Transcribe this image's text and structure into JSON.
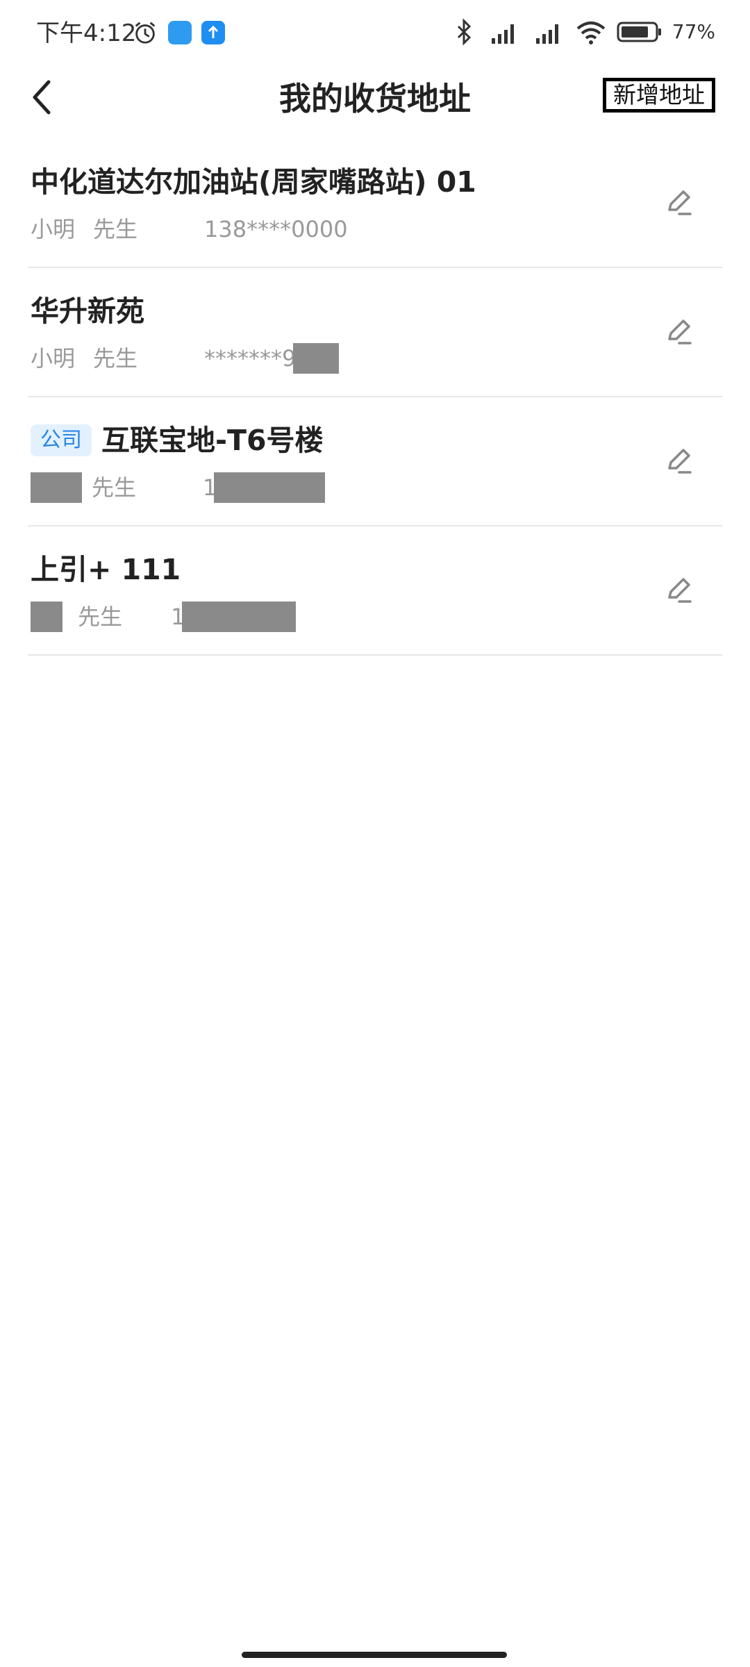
{
  "status_bar": {
    "time": "下午4:12",
    "battery_pct": "77%",
    "icons": [
      "alarm-icon",
      "weather-icon",
      "upload-icon",
      "bluetooth-icon",
      "signal-hd-icon",
      "signal-hd-icon",
      "wifi-icon",
      "battery-icon"
    ]
  },
  "header": {
    "title": "我的收货地址",
    "add_label": "新增地址"
  },
  "addresses": [
    {
      "tag": "",
      "title": "中化道达尔加油站(周家嘴路站) 01",
      "name": "小明",
      "salutation": "先生",
      "phone": "138****0000"
    },
    {
      "tag": "",
      "title": "华升新苑",
      "name": "小明",
      "salutation": "先生",
      "phone": "*******9"
    },
    {
      "tag": "公司",
      "title": "互联宝地-T6号楼",
      "name": "",
      "salutation": "先生",
      "phone": "1"
    },
    {
      "tag": "",
      "title": "上引+ 111",
      "name": "",
      "salutation": "先生",
      "phone": "1"
    }
  ],
  "colors": {
    "tag_bg": "#e3f1ff",
    "tag_text": "#2a86e6",
    "redaction": "#8a8a8a"
  }
}
